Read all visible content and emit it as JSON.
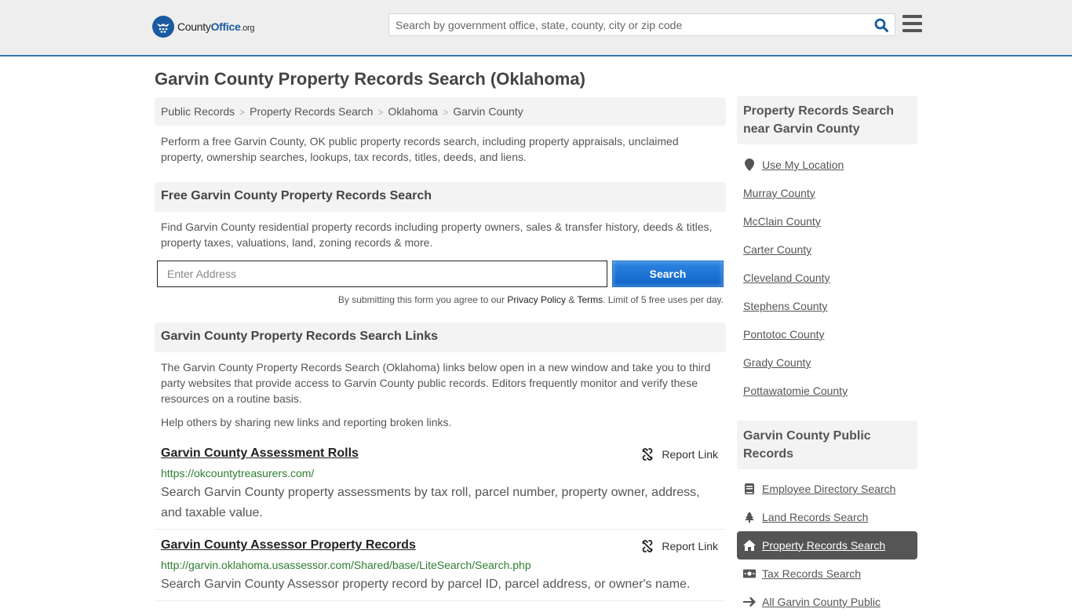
{
  "header": {
    "logo_main": "County",
    "logo_accent": "Office",
    "logo_suffix": ".org",
    "search_placeholder": "Search by government office, state, county, city or zip code"
  },
  "page_title": "Garvin County Property Records Search (Oklahoma)",
  "breadcrumb": [
    "Public Records",
    "Property Records Search",
    "Oklahoma",
    "Garvin County"
  ],
  "intro": "Perform a free Garvin County, OK public property records search, including property appraisals, unclaimed property, ownership searches, lookups, tax records, titles, deeds, and liens.",
  "free_search": {
    "heading": "Free Garvin County Property Records Search",
    "description": "Find Garvin County residential property records including property owners, sales & transfer history, deeds & titles, property taxes, valuations, land, zoning records & more.",
    "address_placeholder": "Enter Address",
    "button_label": "Search",
    "terms_prefix": "By submitting this form you agree to our ",
    "privacy_label": "Privacy Policy",
    "terms_amp": " & ",
    "terms_label": "Terms",
    "terms_suffix": ". Limit of 5 free uses per day."
  },
  "links_section": {
    "heading": "Garvin County Property Records Search Links",
    "description": "The Garvin County Property Records Search (Oklahoma) links below open in a new window and take you to third party websites that provide access to Garvin County public records. Editors frequently monitor and verify these resources on a routine basis.",
    "help_prefix": "Help others by sharing ",
    "help_link": "new links",
    "help_suffix": " and reporting broken links.",
    "report_label": "Report Link",
    "items": [
      {
        "title": "Garvin County Assessment Rolls",
        "url": "https://okcountytreasurers.com/",
        "description": "Search Garvin County property assessments by tax roll, parcel number, property owner, address, and taxable value."
      },
      {
        "title": "Garvin County Assessor Property Records",
        "url": "http://garvin.oklahoma.usassessor.com/Shared/base/LiteSearch/Search.php",
        "description": "Search Garvin County Assessor property record by parcel ID, parcel address, or owner's name."
      }
    ]
  },
  "sidebar": {
    "nearby_heading": "Property Records Search near Garvin County",
    "use_location": "Use My Location",
    "nearby": [
      "Murray County",
      "McClain County",
      "Carter County",
      "Cleveland County",
      "Stephens County",
      "Pontotoc County",
      "Grady County",
      "Pottawatomie County"
    ],
    "public_heading": "Garvin County Public Records",
    "public_links": [
      {
        "label": "Employee Directory Search",
        "icon": "book-icon"
      },
      {
        "label": "Land Records Search",
        "icon": "tree-icon"
      },
      {
        "label": "Property Records Search",
        "icon": "home-icon",
        "active": true
      },
      {
        "label": "Tax Records Search",
        "icon": "money-icon"
      },
      {
        "label": "All Garvin County Public",
        "icon": "arrow-right-icon"
      }
    ]
  },
  "colors": {
    "brand_blue": "#1a5aa0",
    "header_border": "#3a7ab0",
    "url_green": "#2e7d32",
    "active_bg": "#555555"
  }
}
